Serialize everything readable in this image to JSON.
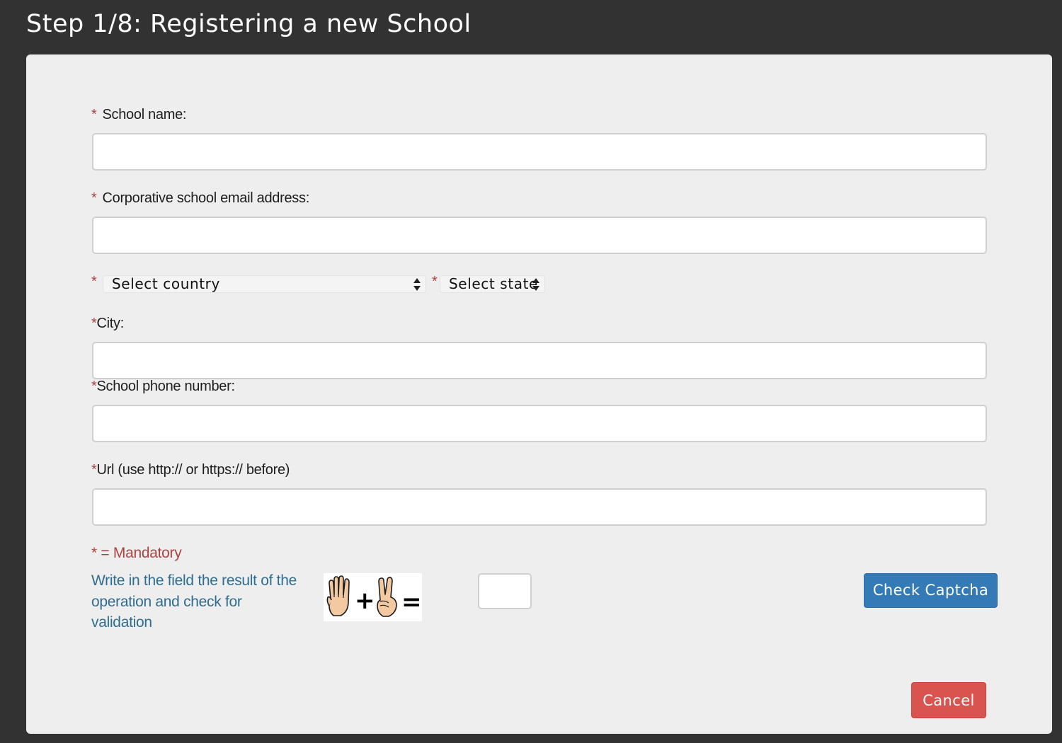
{
  "header": {
    "title": "Step 1/8: Registering a new School"
  },
  "form": {
    "required_marker": "*",
    "school_name": {
      "label": "School name:",
      "value": ""
    },
    "email": {
      "label": "Corporative school email address:",
      "value": ""
    },
    "country_select": {
      "selected": "Select country"
    },
    "state_select": {
      "selected": "Select state"
    },
    "city": {
      "label": "City:",
      "value": ""
    },
    "phone": {
      "label": "School phone number:",
      "value": ""
    },
    "url": {
      "label": "Url (use http:// or https:// before)",
      "value": ""
    },
    "mandatory_note": "* = Mandatory"
  },
  "captcha": {
    "instructions": "Write in the field the result of the operation and check for validation",
    "operation": {
      "left_operand": 4,
      "operator": "+",
      "right_operand": 2,
      "equals": "="
    },
    "answer_value": "",
    "check_button_label": "Check Captcha"
  },
  "actions": {
    "cancel_label": "Cancel"
  },
  "colors": {
    "background": "#323232",
    "panel": "#eeeeee",
    "required": "#a94442",
    "info_text": "#2f6d8f",
    "primary_button": "#337ab7",
    "danger_button": "#d9534f"
  }
}
